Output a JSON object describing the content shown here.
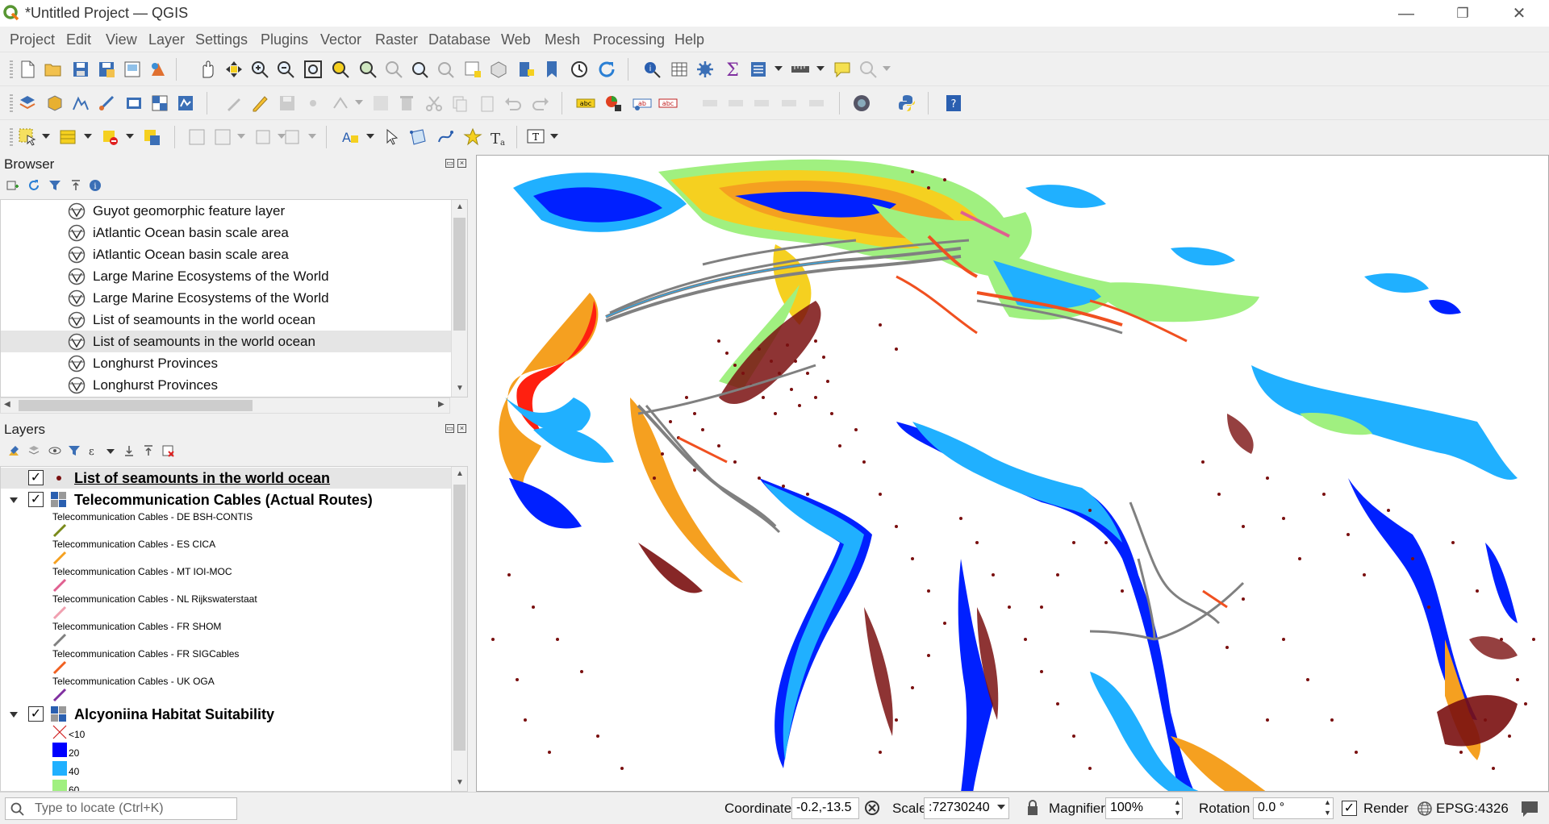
{
  "window": {
    "title": "*Untitled Project — QGIS",
    "minimize": "—",
    "restore": "❐",
    "close": "✕"
  },
  "menu": [
    "Project",
    "Edit",
    "View",
    "Layer",
    "Settings",
    "Plugins",
    "Vector",
    "Raster",
    "Database",
    "Web",
    "Mesh",
    "Processing",
    "Help"
  ],
  "browser": {
    "title": "Browser",
    "items": [
      {
        "label": "Guyot geomorphic feature layer",
        "selected": false
      },
      {
        "label": "iAtlantic Ocean basin scale area",
        "selected": false
      },
      {
        "label": "iAtlantic Ocean basin scale area",
        "selected": false
      },
      {
        "label": "Large Marine Ecosystems of the World",
        "selected": false
      },
      {
        "label": "Large Marine Ecosystems of the World",
        "selected": false
      },
      {
        "label": "List of seamounts in the world ocean",
        "selected": false
      },
      {
        "label": "List of seamounts in the world ocean",
        "selected": true
      },
      {
        "label": "Longhurst Provinces",
        "selected": false
      },
      {
        "label": "Longhurst Provinces",
        "selected": false
      }
    ]
  },
  "layers": {
    "title": "Layers",
    "seamounts": {
      "name": "List of seamounts in the world ocean",
      "checked": true,
      "color": "#7a1010"
    },
    "cables": {
      "name": "Telecommunication Cables (Actual Routes)",
      "checked": true,
      "items": [
        {
          "label": "Telecommunication Cables - DE BSH-CONTIS",
          "color": "#7a8a1a"
        },
        {
          "label": "Telecommunication Cables - ES CICA",
          "color": "#f5a020"
        },
        {
          "label": "Telecommunication Cables - MT IOI-MOC",
          "color": "#e06090"
        },
        {
          "label": "Telecommunication Cables - NL Rijkswaterstaat",
          "color": "#f0a0b0"
        },
        {
          "label": "Telecommunication Cables - FR SHOM",
          "color": "#808080"
        },
        {
          "label": "Telecommunication Cables - FR SIGCables",
          "color": "#f06020"
        },
        {
          "label": "Telecommunication Cables - UK OGA",
          "color": "#8030a0"
        }
      ]
    },
    "habitat": {
      "name": "Alcyoniina Habitat Suitability",
      "checked": true,
      "classes": [
        {
          "label": "<10",
          "color": "none"
        },
        {
          "label": "20",
          "color": "#0000ff"
        },
        {
          "label": "40",
          "color": "#20b0ff"
        },
        {
          "label": "60",
          "color": "#a0f080"
        }
      ]
    }
  },
  "status": {
    "locate_placeholder": "Type to locate (Ctrl+K)",
    "coordinate_label": "Coordinate",
    "coordinate_value": "-0.2,-13.5",
    "scale_label": "Scale",
    "scale_value": ":72730240",
    "magnifier_label": "Magnifier",
    "magnifier_value": "100%",
    "rotation_label": "Rotation",
    "rotation_value": "0.0 °",
    "render_label": "Render",
    "render_checked": true,
    "crs": "EPSG:4326"
  },
  "map_colors": {
    "seamount": "#7a1010",
    "cable_grey": "#808080",
    "cable_red": "#f05020",
    "deep_blue": "#0020ff",
    "light_blue": "#20b0ff",
    "green": "#a0f080",
    "yellow": "#f5d020",
    "orange": "#f5a020",
    "red": "#ff2010"
  }
}
